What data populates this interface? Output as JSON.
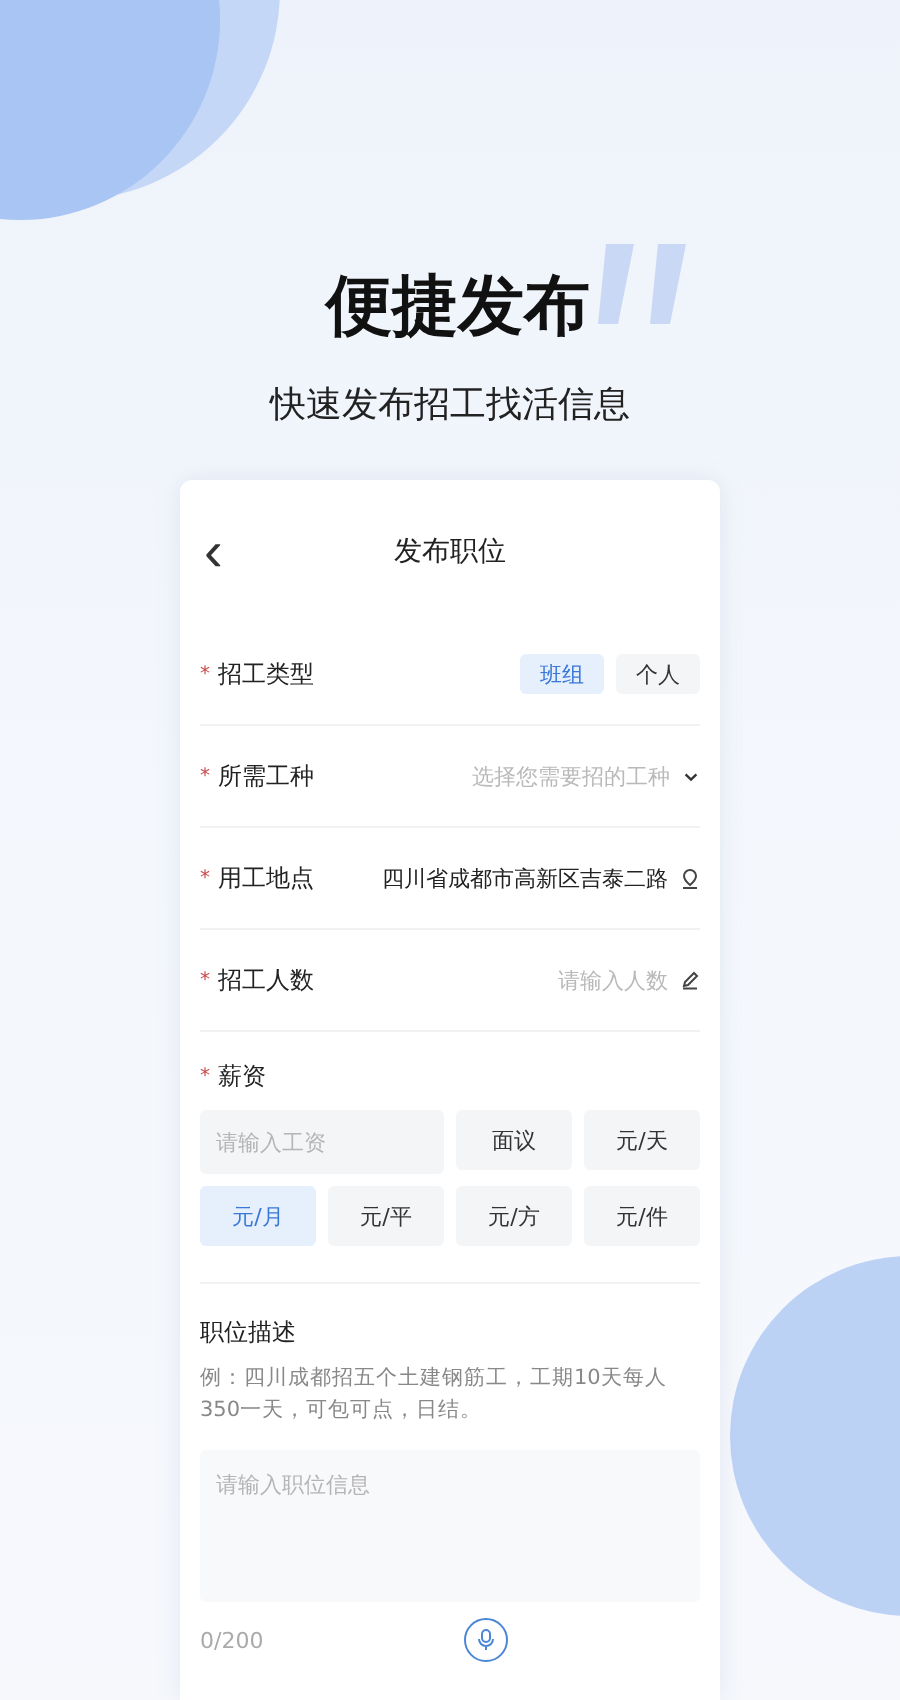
{
  "headline": {
    "title": "便捷发布",
    "subtitle": "快速发布招工找活信息"
  },
  "screen": {
    "back": "‹",
    "title": "发布职位"
  },
  "fields": [
    {
      "kind": "toggle",
      "marker": "*",
      "label": "招工类型",
      "options": [
        {
          "label": "班组",
          "selected": true
        },
        {
          "label": "个人",
          "selected": false
        }
      ]
    },
    {
      "kind": "select",
      "marker": "*",
      "label": "所需工种",
      "placeholder": "选择您需要招的工种"
    },
    {
      "kind": "location",
      "marker": "*",
      "label": "用工地点",
      "value": "四川省成都市高新区吉泰二路"
    },
    {
      "kind": "edit",
      "marker": "*",
      "label": "招工人数",
      "placeholder": "请输入人数"
    }
  ],
  "salary": {
    "marker": "*",
    "label": "薪资",
    "placeholder": "请输入工资",
    "units": [
      {
        "label": "面议",
        "selected": false
      },
      {
        "label": "元/天",
        "selected": false
      },
      {
        "label": "元/月",
        "selected": true
      },
      {
        "label": "元/平",
        "selected": false
      },
      {
        "label": "元/方",
        "selected": false
      },
      {
        "label": "元/件",
        "selected": false
      }
    ]
  },
  "description": {
    "label": "职位描述",
    "example": "例：四川成都招五个土建钢筋工，工期10天每人350一天，可包可点，日结。",
    "placeholder": "请输入职位信息",
    "counter": "0/200"
  }
}
